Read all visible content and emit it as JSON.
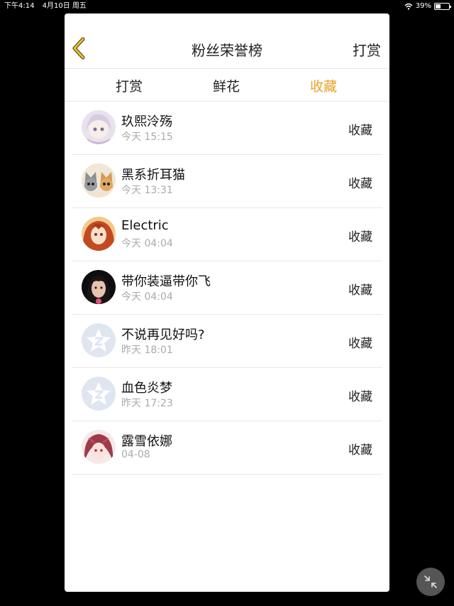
{
  "status_bar": {
    "time": "下午4:14",
    "date": "4月10日 周五",
    "battery": "39%",
    "battery_level": 0.39
  },
  "header": {
    "title": "粉丝荣誉榜",
    "action_label": "打赏"
  },
  "tabs": [
    {
      "label": "打赏",
      "active": false
    },
    {
      "label": "鲜花",
      "active": false
    },
    {
      "label": "收藏",
      "active": true
    }
  ],
  "rows": [
    {
      "name": "玖熙泠殇",
      "time": "今天 15:15",
      "action": "收藏",
      "avatar": "anime-girl-avatar"
    },
    {
      "name": "黑系折耳猫",
      "time": "今天 13:31",
      "action": "收藏",
      "avatar": "cats-avatar"
    },
    {
      "name": "Electric",
      "time": "今天 04:04",
      "action": "收藏",
      "avatar": "anime-redhair-avatar"
    },
    {
      "name": "带你装逼带你飞",
      "time": "今天 04:04",
      "action": "收藏",
      "avatar": "photo-girl-avatar"
    },
    {
      "name": "不说再见好吗?",
      "time": "昨天 18:01",
      "action": "收藏",
      "avatar": "default-qzone-avatar"
    },
    {
      "name": "血色炎梦",
      "time": "昨天 17:23",
      "action": "收藏",
      "avatar": "default-qzone-avatar"
    },
    {
      "name": "露雪依娜",
      "time": "04-08",
      "action": "收藏",
      "avatar": "anime-pink-avatar"
    }
  ],
  "colors": {
    "accent": "#E9A024",
    "background": "#000000",
    "panel": "#FFFFFF"
  }
}
